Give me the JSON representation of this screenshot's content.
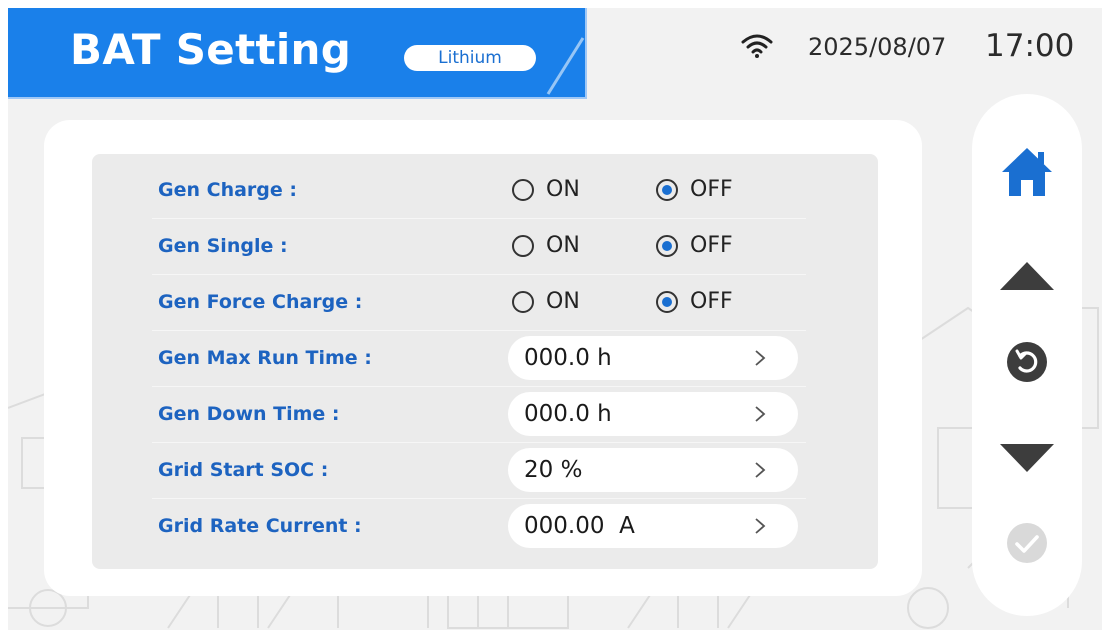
{
  "header": {
    "title": "BAT Setting",
    "battery_type_badge": "Lithium",
    "date": "2025/08/07",
    "time": "17:00",
    "wifi_icon": "wifi-icon"
  },
  "colors": {
    "header_blue": "#1a80ea",
    "label_blue": "#1d63c0",
    "radio_selected": "#1a6fd1",
    "panel_bg": "#ebebeb",
    "nav_icon_dark": "#444444",
    "nav_icon_disabled": "#d9d9d9"
  },
  "settings": {
    "radio_rows": [
      {
        "label": "Gen Charge :",
        "on_label": "ON",
        "off_label": "OFF",
        "selected": "OFF"
      },
      {
        "label": "Gen Single :",
        "on_label": "ON",
        "off_label": "OFF",
        "selected": "OFF"
      },
      {
        "label": "Gen Force Charge :",
        "on_label": "ON",
        "off_label": "OFF",
        "selected": "OFF"
      }
    ],
    "value_rows": [
      {
        "label": "Gen Max Run Time :",
        "value": "000.0 h"
      },
      {
        "label": "Gen Down Time :",
        "value": "000.0 h"
      },
      {
        "label": "Grid Start SOC :",
        "value": "20 %"
      },
      {
        "label": "Grid Rate Current :",
        "value": "000.00  A"
      }
    ]
  },
  "side_nav": {
    "icons": [
      "home-icon",
      "arrow-up-icon",
      "back-icon",
      "arrow-down-icon",
      "confirm-icon"
    ],
    "confirm_enabled": false
  }
}
